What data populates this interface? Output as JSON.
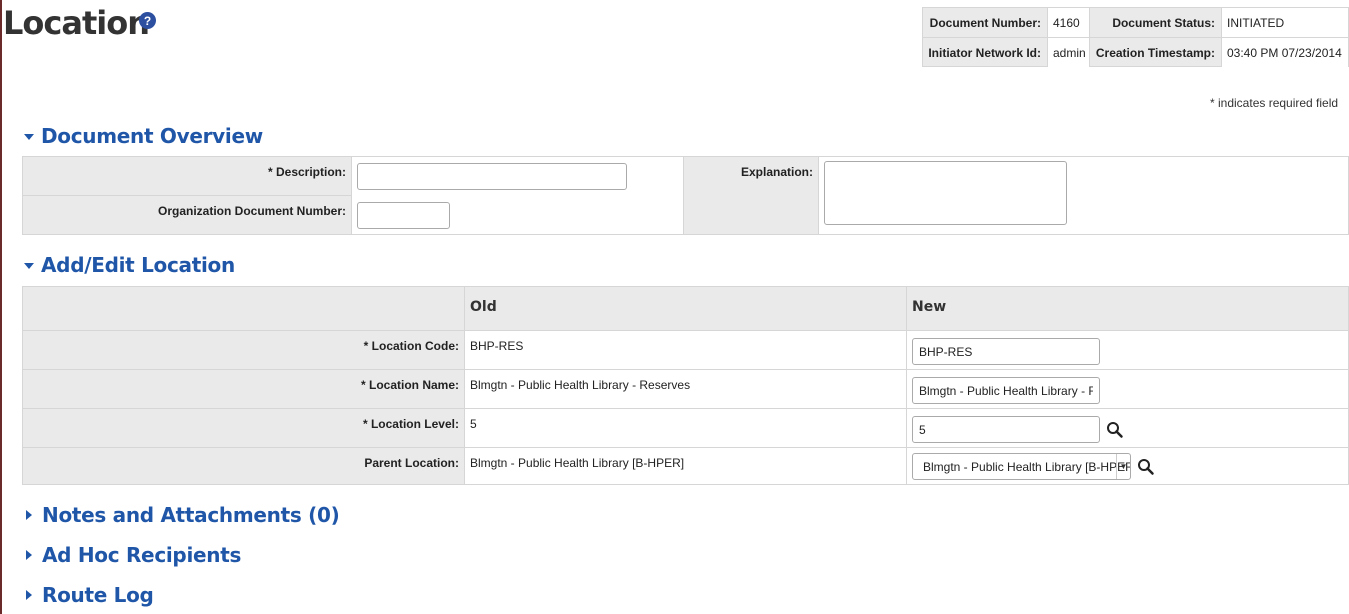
{
  "page": {
    "title": "Location",
    "help_icon": "?"
  },
  "doc_header": {
    "number_label": "Document Number:",
    "number_value": "4160",
    "status_label": "Document Status:",
    "status_value": "INITIATED",
    "initiator_label": "Initiator Network Id:",
    "initiator_value": "admin",
    "created_label": "Creation Timestamp:",
    "created_value": "03:40 PM 07/23/2014"
  },
  "required_note": "* indicates required field",
  "overview": {
    "title": "Document Overview",
    "description_label": "* Description:",
    "description_value": "",
    "org_doc_label": "Organization Document Number:",
    "org_doc_value": "",
    "explanation_label": "Explanation:",
    "explanation_value": ""
  },
  "edit": {
    "title": "Add/Edit Location",
    "old_header": "Old",
    "new_header": "New",
    "rows": [
      {
        "label": "* Location Code:",
        "old": "BHP-RES",
        "new": "BHP-RES"
      },
      {
        "label": "* Location Name:",
        "old": "Blmgtn - Public Health Library - Reserves",
        "new": "Blmgtn - Public Health Library - Reserves"
      },
      {
        "label": "* Location Level:",
        "old": "5",
        "new": "5"
      },
      {
        "label": "Parent Location:",
        "old": "Blmgtn - Public Health Library [B-HPER]",
        "new": "Blmgtn - Public Health Library [B-HPER]"
      }
    ]
  },
  "sections": {
    "notes": "Notes and Attachments (0)",
    "adhoc": "Ad Hoc Recipients",
    "route": "Route Log"
  },
  "colors": {
    "accent": "#1f56a8",
    "label_bg": "#eaeaea",
    "border": "#d6d6d6"
  },
  "icons": {
    "help": "help-icon",
    "lookup": "magnifier-icon",
    "expand": "triangle-down-icon",
    "collapse": "triangle-right-icon"
  }
}
